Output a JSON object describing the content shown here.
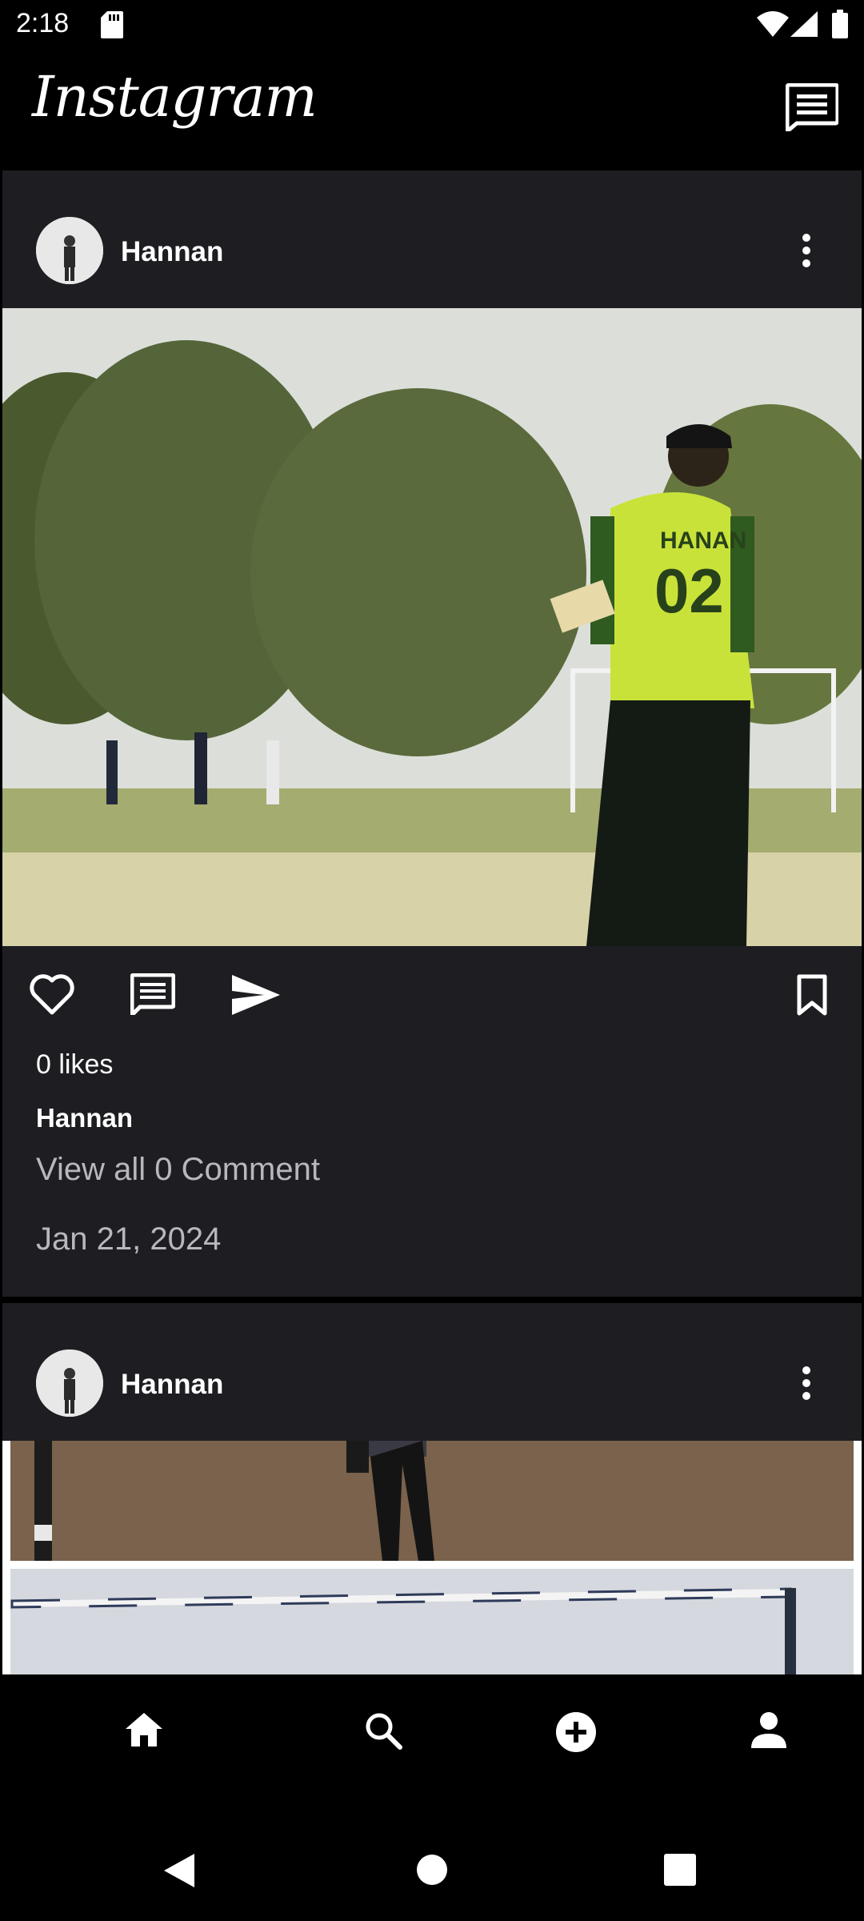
{
  "status": {
    "time": "2:18"
  },
  "header": {
    "logo": "Instagram"
  },
  "posts": [
    {
      "username": "Hannan",
      "likes": "0 likes",
      "caption_user": "Hannan",
      "comments": "View all 0 Comment",
      "date": "Jan 21, 2024",
      "jersey_name": "HANAN",
      "jersey_number": "02"
    },
    {
      "username": "Hannan"
    }
  ],
  "icons": {
    "status": [
      "sd-card-icon",
      "wifi-icon",
      "signal-icon",
      "battery-icon"
    ],
    "header": [
      "messages-icon"
    ],
    "post": [
      "more-vertical-icon",
      "heart-icon",
      "comment-icon",
      "send-icon",
      "bookmark-icon"
    ],
    "nav": [
      "home-icon",
      "search-icon",
      "add-circle-icon",
      "profile-icon"
    ],
    "system": [
      "back-icon",
      "home-circle-icon",
      "recents-icon"
    ]
  },
  "colors": {
    "background": "#000000",
    "card": "#1e1e22",
    "muted_text": "#b7b7bd",
    "jersey": "#c9e23a"
  }
}
